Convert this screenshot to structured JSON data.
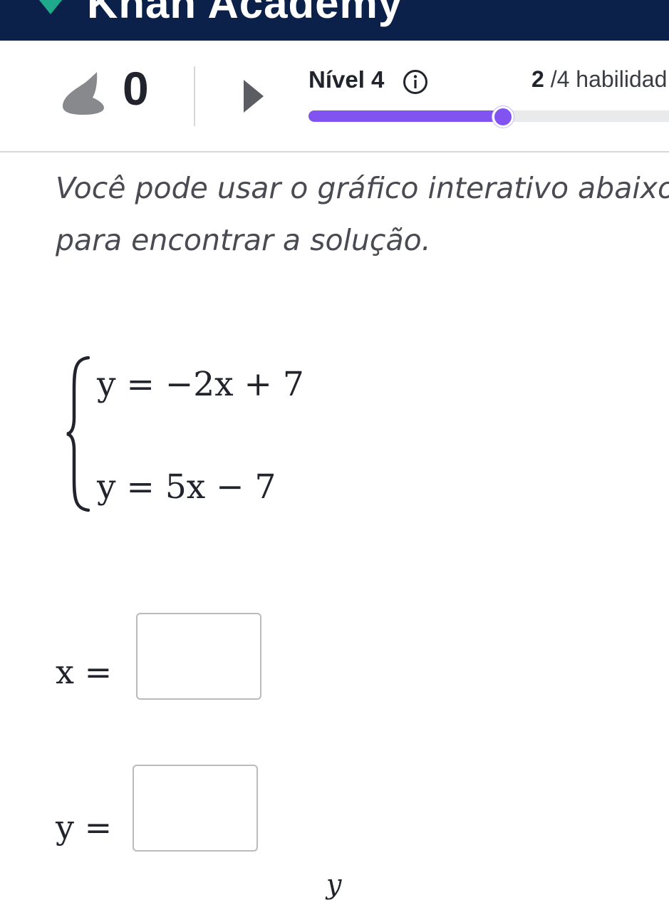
{
  "header": {
    "brand": "Khan Academy",
    "icons": {
      "logo": "khan-leaf-icon",
      "search": "search-icon"
    },
    "colors": {
      "background": "#0b2149",
      "logo": "#1fab8b"
    }
  },
  "progress": {
    "streak_count": "0",
    "level_label": "Nível 4",
    "skills_current": "2",
    "skills_rest": " /4 habilidad",
    "progress_fraction": 0.54,
    "colors": {
      "accent": "#8153f0",
      "track": "#e9eaec"
    }
  },
  "content": {
    "prompt_line1": "Você pode usar o gráfico interativo abaixo",
    "prompt_line2": "para encontrar a solução.",
    "system": {
      "eq1": "y = −2x + 7",
      "eq2": "y = 5x − 7"
    },
    "answers": {
      "x_label": "x =",
      "y_label": "y =",
      "x_value": "",
      "y_value": ""
    },
    "graph_axis_label": "y"
  }
}
